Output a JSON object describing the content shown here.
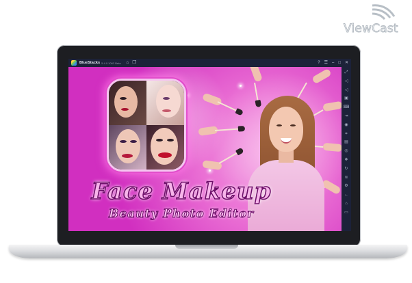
{
  "watermark": {
    "text": "ViewCast"
  },
  "window": {
    "app_name": "BlueStacks",
    "version": "5.4.0.1063 Beta",
    "left_icons": [
      "home-icon",
      "multi-instance-icon"
    ],
    "right_icons": [
      "help-icon",
      "menu-icon",
      "minimize-icon",
      "maximize-icon",
      "close-icon"
    ]
  },
  "sidebar": {
    "icons": [
      "fullscreen-icon",
      "volume-up-icon",
      "volume-down-icon",
      "screen-record-icon",
      "keyboard-icon",
      "install-apk-icon",
      "macro-icon",
      "screenshot-icon",
      "folder-icon",
      "location-icon",
      "eco-mode-icon",
      "rotate-icon",
      "shake-icon",
      "settings-icon",
      "back-icon",
      "home-icon",
      "recent-apps-icon"
    ]
  },
  "banner": {
    "title": "Face Makeup",
    "subtitle": "Beauty Photo Editor",
    "colors": {
      "background": "#d62fc4",
      "title_fill": "#f7b5ea",
      "title_outline": "#6e0f6a"
    }
  }
}
